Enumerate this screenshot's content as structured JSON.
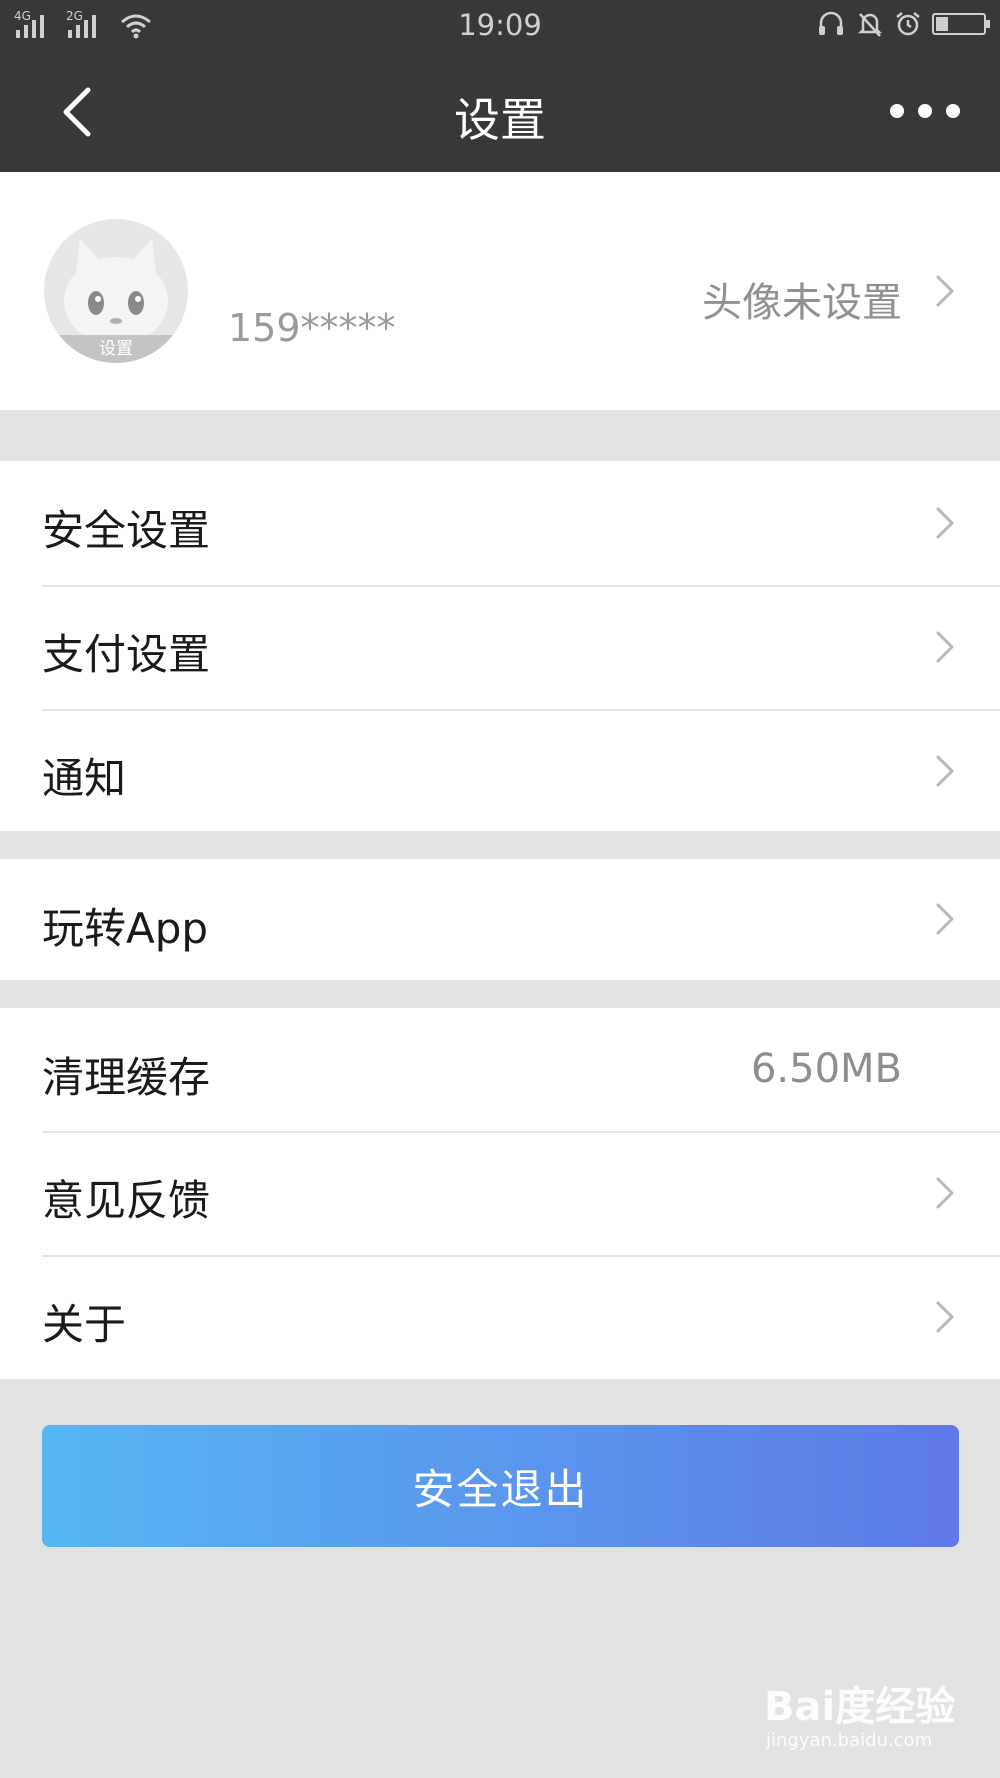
{
  "status_bar": {
    "time": "19:09",
    "signal_1": "4G",
    "signal_2": "2G",
    "battery_level": 0.25,
    "icons": [
      "headset-icon",
      "bell-off-icon",
      "alarm-icon",
      "battery-icon"
    ]
  },
  "header": {
    "title": "设置",
    "back_icon": "chevron-left-icon",
    "more_icon": "more-dots-icon"
  },
  "profile": {
    "avatar_label": "设置",
    "phone": "159*****",
    "avatar_hint": "头像未设置"
  },
  "menu_groups": [
    [
      {
        "label": "安全设置",
        "value": "",
        "chevron": true
      },
      {
        "label": "支付设置",
        "value": "",
        "chevron": true
      },
      {
        "label": "通知",
        "value": "",
        "chevron": true
      }
    ],
    [
      {
        "label": "玩转App",
        "value": "",
        "chevron": true
      }
    ],
    [
      {
        "label": "清理缓存",
        "value": "6.50MB",
        "chevron": false
      },
      {
        "label": "意见反馈",
        "value": "",
        "chevron": true
      },
      {
        "label": "关于",
        "value": "",
        "chevron": true
      }
    ]
  ],
  "logout_label": "安全退出",
  "watermark": {
    "logo": "Bai度经验",
    "url": "jingyan.baidu.com"
  },
  "colors": {
    "header_bg": "#383838",
    "page_bg": "#e2e2e2",
    "button_gradient_start": "#55b6f3",
    "button_gradient_end": "#5f79e8"
  }
}
